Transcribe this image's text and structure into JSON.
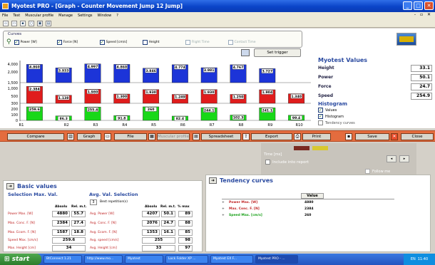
{
  "window": {
    "title": "Myotest PRO - [Graph - Counter Movement Jump 12 Jump]",
    "controls": [
      "_",
      "□",
      "✕"
    ]
  },
  "menu": {
    "items": [
      "File",
      "Test",
      "Muscular profile",
      "Manage",
      "Settings",
      "Window",
      "?"
    ],
    "mdi_controls": "- ▫ ✕"
  },
  "curves": {
    "label": "Curves",
    "items": [
      {
        "label": "Power [W]",
        "checked": true
      },
      {
        "label": "Force [N]",
        "checked": true
      },
      {
        "label": "Speed [cm/s]",
        "checked": true
      },
      {
        "label": "Height",
        "checked": false
      },
      {
        "label": "Flight Time",
        "checked": false
      },
      {
        "label": "Contact Time",
        "checked": false
      }
    ],
    "trigger_button": "Set trigger"
  },
  "chart_data": {
    "type": "bar",
    "categories": [
      "R1",
      "R2",
      "R3",
      "R4",
      "R5",
      "R6",
      "R7",
      "R8",
      "R9",
      "R10"
    ],
    "series": [
      {
        "name": "Power [W]",
        "color": "#1c34d8",
        "values": [
          4860,
          3933,
          4997,
          4860,
          3846,
          4774,
          3981,
          4767,
          3727
        ],
        "labels": [
          "4.860",
          "3.933",
          "4.997",
          "4.860",
          "3.846",
          "4.774",
          "3.981",
          "4.767",
          "3.727"
        ]
      },
      {
        "name": "Force [N]",
        "color": "#e01c1c",
        "values": [
          2384,
          1138,
          1980,
          1300,
          1930,
          1249,
          1930,
          1250,
          1904,
          1340
        ],
        "labels": [
          "2.384",
          "1.138",
          "1.980",
          "1.300",
          "1.930",
          "1.249",
          "1.930",
          "1.250",
          "1.904",
          "1.340"
        ]
      },
      {
        "name": "Speed [cm/s]",
        "color": "#18d818",
        "values": [
          259.6,
          86.3,
          255.4,
          91.8,
          260.0,
          82.4,
          244.1,
          102.3,
          241.1,
          99.4
        ],
        "labels": [
          "259.6",
          "86.3",
          "255.4",
          "91.8",
          "260",
          "82.4",
          "244.1",
          "102.3",
          "241.1",
          "99.4"
        ]
      }
    ],
    "y_ticks": [
      "4,000",
      "2,000",
      "1,500",
      "1,000",
      "500",
      "300",
      "200",
      "100",
      "0"
    ]
  },
  "myotest_values": {
    "title": "Myotest Values",
    "rows": [
      {
        "label": "Height",
        "value": "33.1"
      },
      {
        "label": "Power",
        "value": "50.1"
      },
      {
        "label": "Force",
        "value": "24.7"
      },
      {
        "label": "Speed",
        "value": "254.9"
      }
    ],
    "histogram_title": "Histogram",
    "histogram_items": [
      {
        "label": "Values",
        "checked": true
      },
      {
        "label": "Histogram",
        "checked": true
      },
      {
        "label": "Tendency curves",
        "checked": false
      }
    ]
  },
  "button_bar": {
    "compare": "Compare",
    "graph": "Graph",
    "file": "File",
    "muscular_profile": "Muscular profile",
    "spreadsheet": "Spreadsheet",
    "export": "Export",
    "print": "Print",
    "save": "Save",
    "close": "Close"
  },
  "lower_mid": {
    "time_label": "Time [ms]",
    "include_label": "Include into report",
    "follow_label": "Follow me",
    "swatch_colors": [
      "#7a2a20",
      "#d8c830"
    ]
  },
  "basic_values": {
    "title": "Basic values",
    "sel_max_title": "Selection Max. Val.",
    "avg_title": "Avg. Val. Selection",
    "best_count": "3",
    "best_label": "Best repetition(s)",
    "max_cols": [
      "Absolu",
      "Rel. m.t."
    ],
    "avg_cols": [
      "Absolu",
      "Rel. m.t.",
      "% max"
    ],
    "max_rows": [
      {
        "label": "Power Max. [W]",
        "abs": "4880",
        "rel": "55.7"
      },
      {
        "label": "Max. Conc. F. [N]",
        "abs": "2384",
        "rel": "27.4"
      },
      {
        "label": "Max. Ecom. F. [N]",
        "abs": "1587",
        "rel": "18.8"
      },
      {
        "label": "Speed Max. [cm/s]",
        "abs": "259.6",
        "rel": ""
      },
      {
        "label": "Max. Height [cm]",
        "abs": "34",
        "rel": ""
      }
    ],
    "avg_rows": [
      {
        "label": "Avg. Power [W]",
        "abs": "4207",
        "rel": "50.1",
        "pct": "89"
      },
      {
        "label": "Avg. Conc. F. [N]",
        "abs": "2076",
        "rel": "24.7",
        "pct": "88"
      },
      {
        "label": "Avg. Ecom. F. [N]",
        "abs": "1353",
        "rel": "16.1",
        "pct": "85"
      },
      {
        "label": "Avg. speed [cm/s]",
        "abs": "255",
        "rel": "",
        "pct": "98"
      },
      {
        "label": "Avg. Height [cm]",
        "abs": "33",
        "rel": "",
        "pct": "97"
      }
    ]
  },
  "tendency": {
    "title": "Tendency curves",
    "header": "Value",
    "rows": [
      {
        "label": "Power Max. [W]",
        "value": "4880",
        "color": "#c02424"
      },
      {
        "label": "Max. Conc. F. [N]",
        "value": "2384",
        "color": "#c02424"
      },
      {
        "label": "Speed Max. [cm/s]",
        "value": "260",
        "color": "#18a018"
      }
    ]
  },
  "taskbar": {
    "start": "start",
    "tasks": [
      "BtConnect 1.21",
      "http://www.mo...",
      "Myotest",
      "Lock Folder XP ...",
      "Myotest EX F...",
      "Myotest PRO - ..."
    ],
    "tray_lang": "EN",
    "clock": "11:40"
  }
}
